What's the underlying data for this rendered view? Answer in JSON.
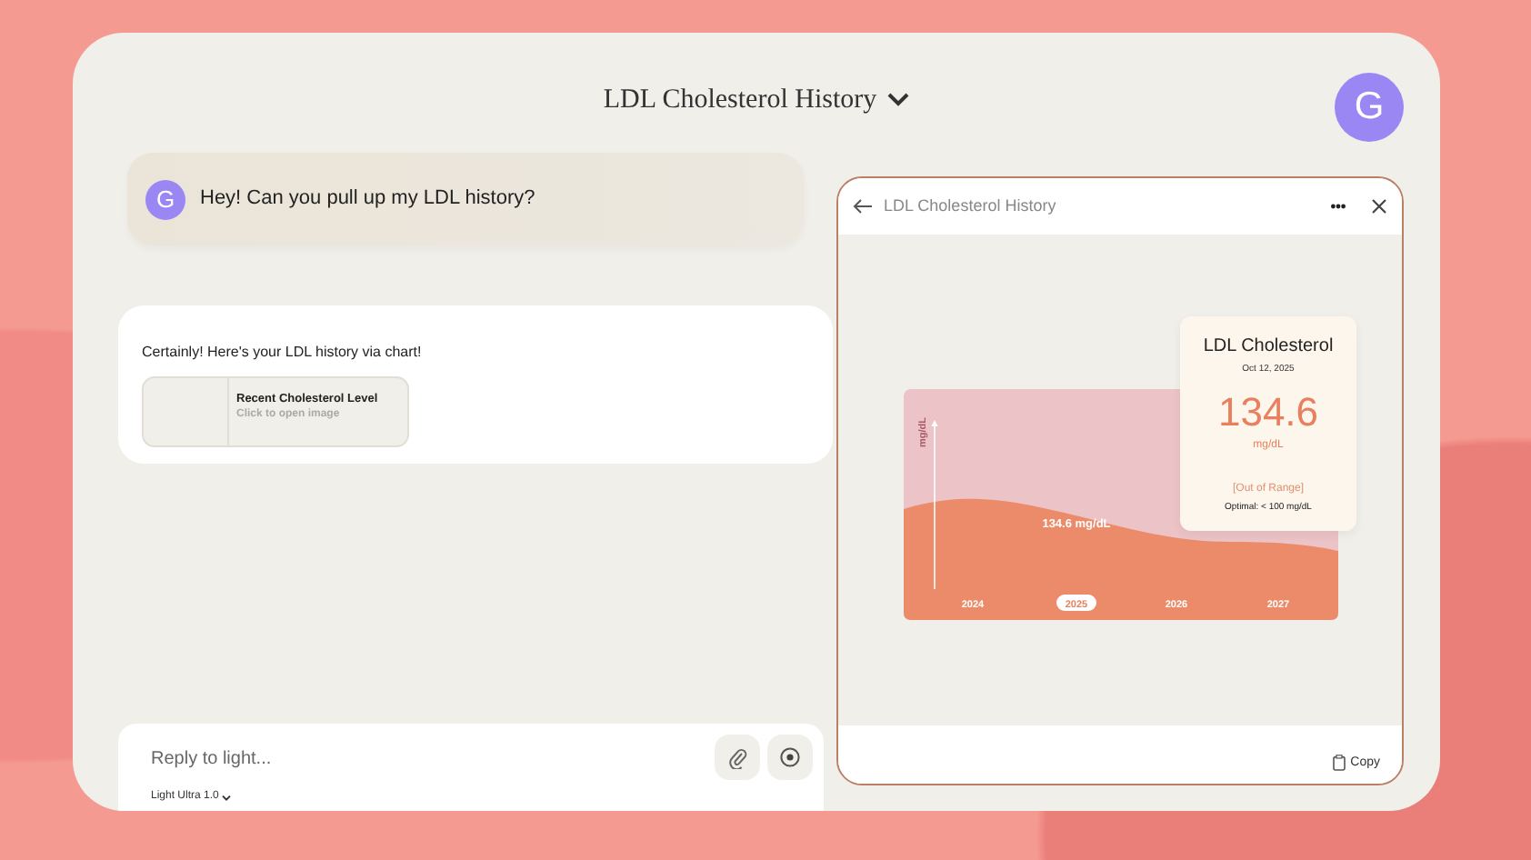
{
  "header": {
    "title": "LDL Cholesterol History",
    "avatar": "G"
  },
  "messages": [
    {
      "kind": "user",
      "avatar": "G",
      "text": "Hey! Can you pull up my LDL history?"
    },
    {
      "kind": "assistant",
      "text": "Certainly! Here's your LDL history via chart!",
      "attachment": {
        "title": "Recent Cholesterol Level",
        "subtitle": "Click to open image"
      }
    }
  ],
  "composer": {
    "placeholder": "Reply to light...",
    "model": "Light Ultra 1.0"
  },
  "viewer": {
    "title": "LDL Cholesterol History",
    "chart": {
      "y_axis_label": "mg/dL",
      "value_label": "134.6 mg/dL",
      "years": [
        {
          "label": "2024",
          "selected": false
        },
        {
          "label": "2025",
          "selected": true
        },
        {
          "label": "2026",
          "selected": false
        },
        {
          "label": "2027",
          "selected": false
        }
      ]
    },
    "detail_card": {
      "title": "LDL Cholesterol",
      "date": "Oct 12, 2025",
      "value": "134.6",
      "unit": "mg/dL",
      "status": "[Out of Range]",
      "note": "Optimal: < 100 mg/dL"
    },
    "copy_label": "Copy"
  }
}
